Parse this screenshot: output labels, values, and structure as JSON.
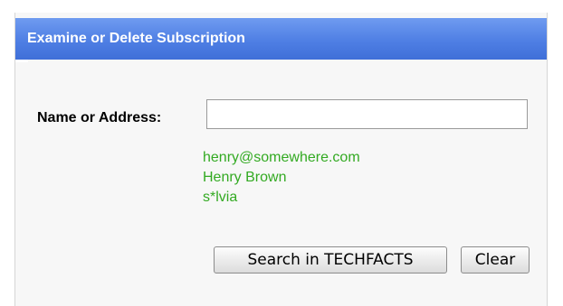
{
  "panel": {
    "title": "Examine or Delete Subscription",
    "header_color": "#4f7fe4"
  },
  "form": {
    "label": "Name or Address:",
    "input_value": "",
    "examples": [
      "henry@somewhere.com",
      "Henry Brown",
      "s*lvia"
    ],
    "example_color": "#33aa22"
  },
  "buttons": {
    "search_label": "Search in TECHFACTS",
    "clear_label": "Clear"
  }
}
